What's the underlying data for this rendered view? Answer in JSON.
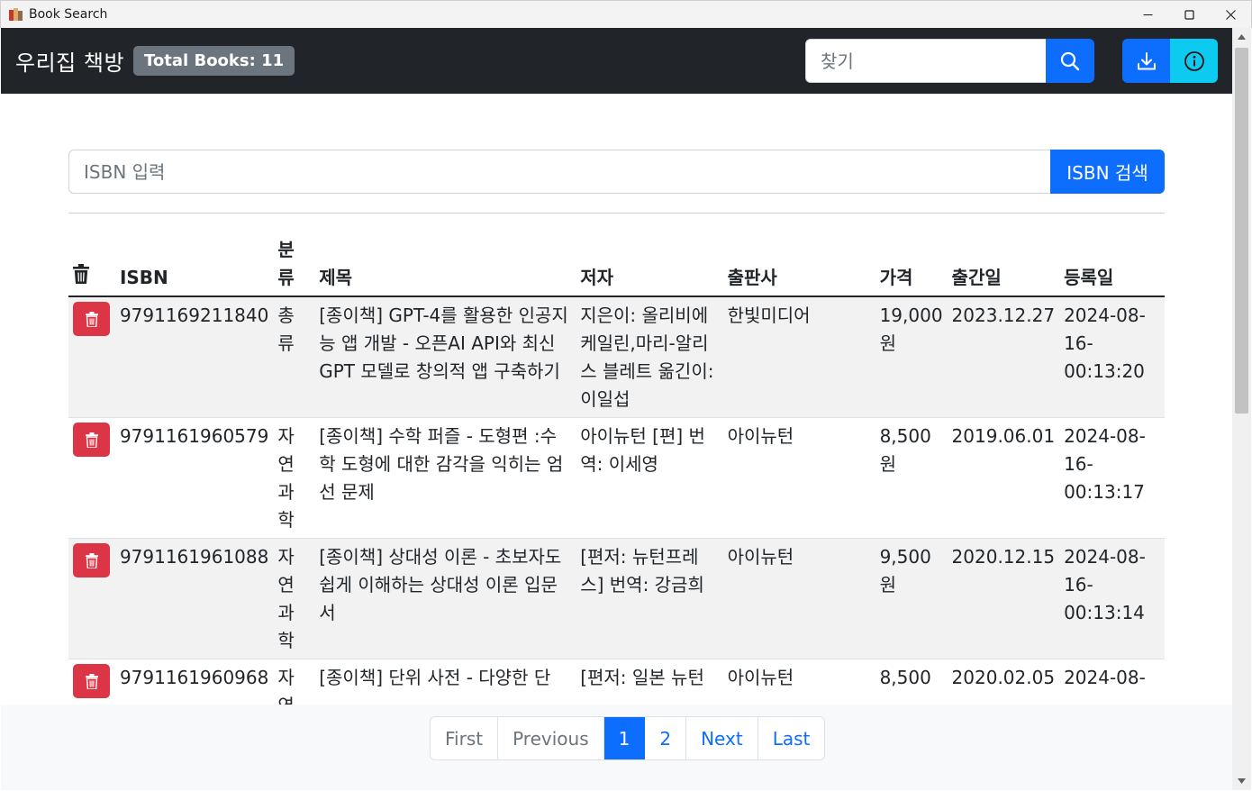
{
  "window": {
    "title": "Book Search"
  },
  "navbar": {
    "brand": "우리집 책방",
    "total_badge": "Total Books: 11",
    "search_placeholder": "찾기"
  },
  "isbn_search": {
    "placeholder": "ISBN 입력",
    "button_label": "ISBN 검색"
  },
  "table": {
    "headers": {
      "isbn": "ISBN",
      "category": "분류",
      "title": "제목",
      "author": "저자",
      "publisher": "출판사",
      "price": "가격",
      "pub_date": "출간일",
      "reg_date": "등록일"
    },
    "rows": [
      {
        "isbn": "9791169211840",
        "category": "총류",
        "title": "[종이책] GPT-4를 활용한 인공지능 앱 개발 - 오픈AI API와 최신 GPT 모델로 창의적 앱 구축하기",
        "author": "지은이: 올리비에 케일린,마리-알리스 블레트 옮긴이: 이일섭",
        "publisher": "한빛미디어",
        "price": "19,000원",
        "pub_date": "2023.12.27",
        "reg_date": "2024-08-16-00:13:20"
      },
      {
        "isbn": "9791161960579",
        "category": "자연과학",
        "title": "[종이책] 수학 퍼즐 - 도형편 :수학 도형에 대한 감각을 익히는 엄선 문제",
        "author": "아이뉴턴 [편] 번역: 이세영",
        "publisher": "아이뉴턴",
        "price": "8,500원",
        "pub_date": "2019.06.01",
        "reg_date": "2024-08-16-00:13:17"
      },
      {
        "isbn": "9791161961088",
        "category": "자연과학",
        "title": "[종이책] 상대성 이론 - 초보자도 쉽게 이해하는 상대성 이론 입문서",
        "author": "[편저: 뉴턴프레스] 번역: 강금희",
        "publisher": "아이뉴턴",
        "price": "9,500원",
        "pub_date": "2020.12.15",
        "reg_date": "2024-08-16-00:13:14"
      },
      {
        "isbn": "9791161960968",
        "category": "자연과학",
        "title": "[종이책] 단위 사전 - 다양한 단",
        "author": "[편저: 일본 뉴턴",
        "publisher": "아이뉴턴",
        "price": "8,500",
        "pub_date": "2020.02.05",
        "reg_date": "2024-08-"
      }
    ]
  },
  "pagination": {
    "first": "First",
    "previous": "Previous",
    "pages": [
      "1",
      "2"
    ],
    "current_page": "1",
    "next": "Next",
    "last": "Last"
  },
  "colors": {
    "navbar_bg": "#212529",
    "primary": "#0d6efd",
    "info": "#0dcaf0",
    "danger": "#dc3545",
    "badge_bg": "#6c757d"
  },
  "icons": [
    "book-app-icon",
    "minimize-icon",
    "maximize-icon",
    "close-icon",
    "search-icon",
    "download-icon",
    "info-icon",
    "trash-icon"
  ]
}
